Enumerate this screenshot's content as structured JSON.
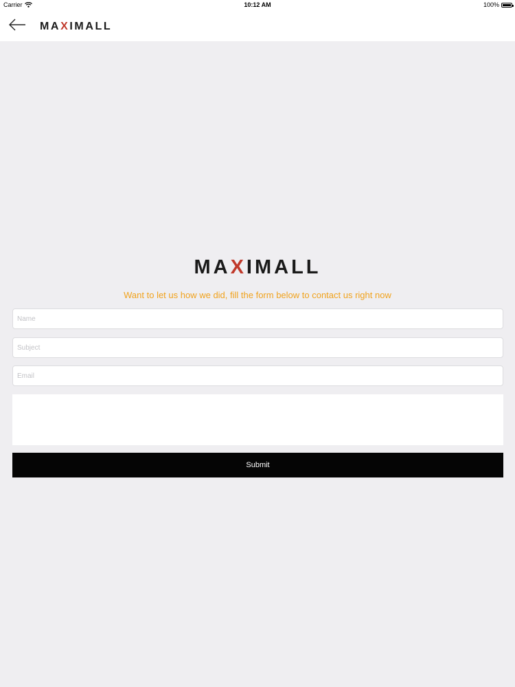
{
  "status_bar": {
    "carrier": "Carrier",
    "time": "10:12 AM",
    "battery": "100%"
  },
  "nav": {
    "logo_prefix": "MA",
    "logo_accent": "X",
    "logo_suffix": "IMALL"
  },
  "main": {
    "logo_prefix": "MA",
    "logo_accent": "X",
    "logo_suffix": "IMALL",
    "tagline": "Want to let us how we did, fill the form below to contact us right now"
  },
  "form": {
    "name_placeholder": "Name",
    "subject_placeholder": "Subject",
    "email_placeholder": "Email",
    "message_placeholder": "",
    "submit_label": "Submit"
  },
  "colors": {
    "background": "#efeef1",
    "tagline": "#f0a21c",
    "logo_accent": "#c0392b",
    "submit_bg": "#050505"
  },
  "icons": {
    "back": "arrow-left-icon",
    "wifi": "wifi-icon",
    "battery": "battery-icon"
  }
}
